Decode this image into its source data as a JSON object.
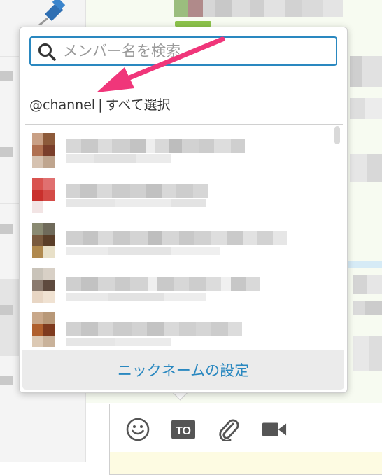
{
  "search": {
    "placeholder": "メンバー名を検索"
  },
  "mention": {
    "channel_label": "@channel",
    "separator": "|",
    "select_all_label": "すべて選択"
  },
  "footer": {
    "nickname_label": "ニックネームの設定"
  },
  "colors": {
    "accent": "#2a88c0",
    "annotation_arrow": "#f0367a"
  },
  "toolbar": [
    {
      "icon": "emoji-icon"
    },
    {
      "icon": "to-icon",
      "text": "TO"
    },
    {
      "icon": "paperclip-icon"
    },
    {
      "icon": "video-icon"
    }
  ]
}
